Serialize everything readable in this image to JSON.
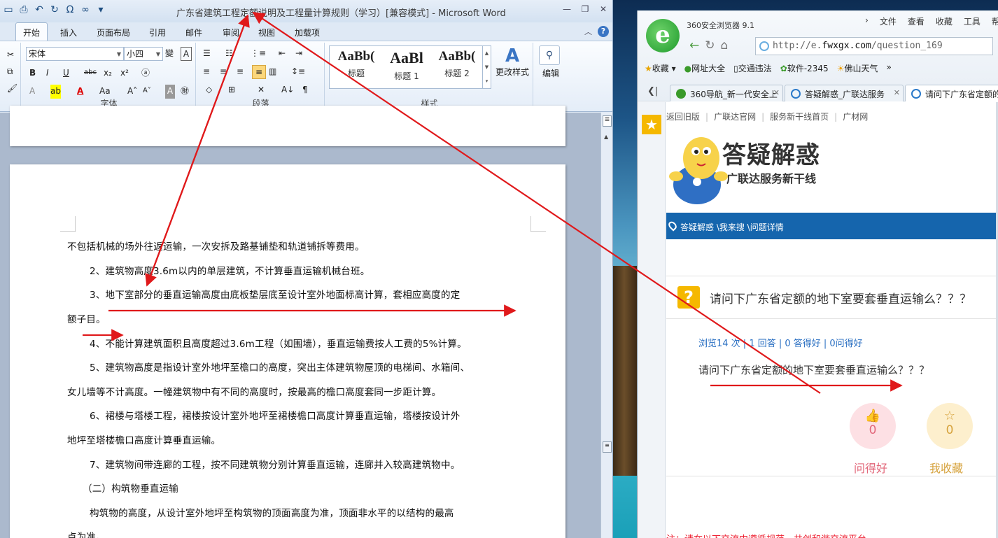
{
  "word": {
    "title": "广东省建筑工程定额说明及工程量计算规则（学习）[兼容模式] - Microsoft Word",
    "tabs": [
      "开始",
      "插入",
      "页面布局",
      "引用",
      "邮件",
      "审阅",
      "视图",
      "加载项"
    ],
    "ribbon": {
      "font_name": "宋体",
      "font_size": "小四",
      "font_group": "字体",
      "paragraph_group": "段落",
      "styles_group": "样式",
      "styles": [
        {
          "sample": "AaBb(",
          "name": "标题"
        },
        {
          "sample": "AaBl",
          "name": "标题 1"
        },
        {
          "sample": "AaBb(",
          "name": "标题 2"
        }
      ],
      "change_styles": "更改样式",
      "edit": "编辑"
    },
    "paragraphs": [
      "不包括机械的场外往返运输，一次安拆及路基铺垫和轨道铺拆等费用。",
      "2、建筑物高度3.6m以内的单层建筑，不计算垂直运输机械台班。",
      "3、地下室部分的垂直运输高度由底板垫层底至设计室外地面标高计算，套相应高度的定",
      "额子目。",
      "4、不能计算建筑面积且高度超过3.6m工程（如围墙），垂直运输费按人工费的5%计算。",
      "5、建筑物高度是指设计室外地坪至檐口的高度，突出主体建筑物屋顶的电梯间、水箱间、",
      "女儿墙等不计高度。一幢建筑物中有不同的高度时，按最高的檐口高度套同一步距计算。",
      "6、裙楼与塔楼工程，裙楼按设计室外地坪至裙楼檐口高度计算垂直运输，塔楼按设计外",
      "地坪至塔楼檐口高度计算垂直运输。",
      "7、建筑物间带连廊的工程，按不同建筑物分别计算垂直运输，连廊并入较高建筑物中。",
      "（二）构筑物垂直运输",
      "构筑物的高度，从设计室外地坪至构筑物的顶面高度为准，顶面非水平的以结构的最高",
      "点为准。"
    ]
  },
  "browser": {
    "name": "360安全浏览器 9.1",
    "menu": [
      "文件",
      "查看",
      "收藏",
      "工具",
      "帮助"
    ],
    "url_prefix": "http://e.",
    "url_domain": "fwxgx.com",
    "url_rest": "/question_169",
    "favorites": [
      "收藏",
      "网址大全",
      "交通违法",
      "软件-2345",
      "佛山天气"
    ],
    "tabs": [
      "360导航_新一代安全上",
      "答疑解惑_广联达服务",
      "请问下广东省定额的"
    ],
    "page": {
      "toplinks": [
        "返回旧版",
        "广联达官网",
        "服务新干线首页",
        "广材网"
      ],
      "site_title": "答疑解惑",
      "site_subtitle": "广联达服务新干线",
      "breadcrumb": "答疑解惑 \\我来搜 \\问题详情",
      "question_title": "请问下广东省定额的地下室要套垂直运输么？？？",
      "stats": "浏览14 次 | 1 回答 | 0 答得好 | 0问得好",
      "question_body": "请问下广东省定额的地下室要套垂直运输么？？？",
      "good_count": "0",
      "good_label": "问得好",
      "fav_count": "0",
      "fav_label": "我收藏",
      "bottom_text": "注：请在以下交流中遵循规范，共创和谐交流平台"
    }
  },
  "colors": {
    "annotation": "#e0191b",
    "breadcrumb_bar": "#1565ad",
    "accent_yellow": "#f5b800"
  }
}
